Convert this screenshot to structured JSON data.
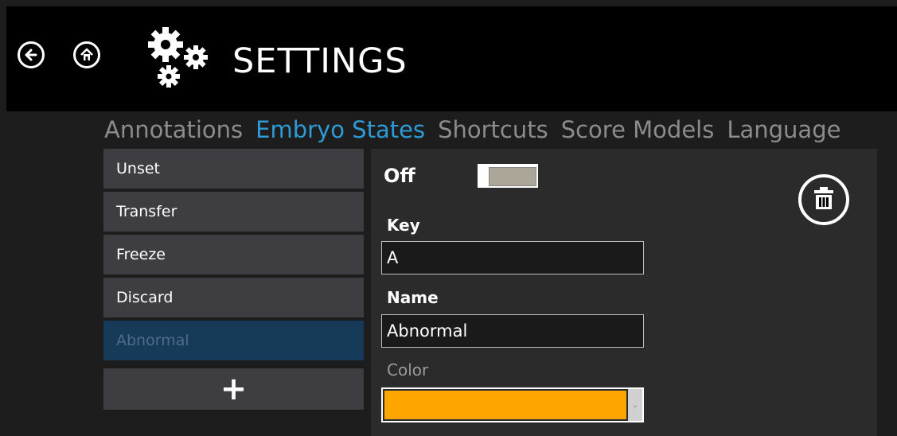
{
  "header": {
    "title": "SETTINGS",
    "back_icon": "back-arrow-icon",
    "home_icon": "home-icon",
    "settings_icon": "gears-icon"
  },
  "tabs": [
    {
      "label": "Annotations",
      "active": false
    },
    {
      "label": "Embryo States",
      "active": true
    },
    {
      "label": "Shortcuts",
      "active": false
    },
    {
      "label": "Score Models",
      "active": false
    },
    {
      "label": "Language",
      "active": false
    }
  ],
  "states": [
    {
      "label": "Unset",
      "selected": false
    },
    {
      "label": "Transfer",
      "selected": false
    },
    {
      "label": "Freeze",
      "selected": false
    },
    {
      "label": "Discard",
      "selected": false
    },
    {
      "label": "Abnormal",
      "selected": true
    }
  ],
  "add_button": {
    "label": "+"
  },
  "detail": {
    "toggle_label": "Off",
    "toggle_on": false,
    "key_label": "Key",
    "key_value": "A",
    "name_label": "Name",
    "name_value": "Abnormal",
    "color_label": "Color",
    "color_value": "#FFA500",
    "delete_icon": "trash-icon"
  },
  "colors": {
    "accent": "#2F9BD6",
    "selected_item_bg": "#163A57",
    "item_bg": "#3E3E42",
    "panel_bg": "#2B2B2B"
  }
}
